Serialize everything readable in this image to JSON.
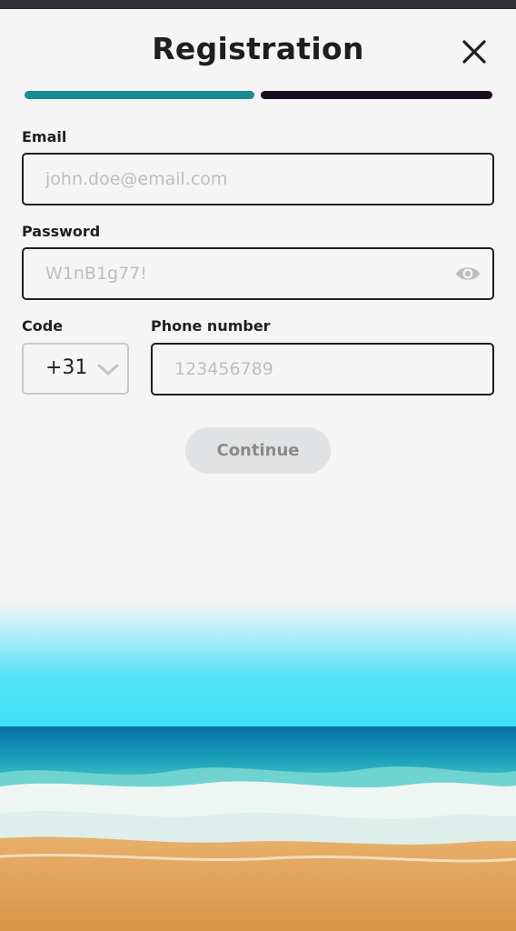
{
  "header": {
    "title": "Registration",
    "close_icon": "close-icon"
  },
  "progress": {
    "steps": [
      {
        "state": "complete",
        "color": "#1a8c92"
      },
      {
        "state": "current",
        "color": "#1a0c1e"
      }
    ]
  },
  "form": {
    "email": {
      "label": "Email",
      "placeholder": "john.doe@email.com",
      "value": ""
    },
    "password": {
      "label": "Password",
      "placeholder": "W1nB1g77!",
      "value": "",
      "toggle_icon": "eye-icon"
    },
    "code": {
      "label": "Code",
      "selected": "+31",
      "icon": "chevron-down-icon"
    },
    "phone": {
      "label": "Phone number",
      "placeholder": "123456789",
      "value": ""
    }
  },
  "actions": {
    "continue_label": "Continue",
    "continue_enabled": false
  },
  "colors": {
    "accent": "#1a8c92",
    "dark": "#1a0c1e",
    "background": "#f5f5f5",
    "button_disabled": "#e0e2e4"
  }
}
